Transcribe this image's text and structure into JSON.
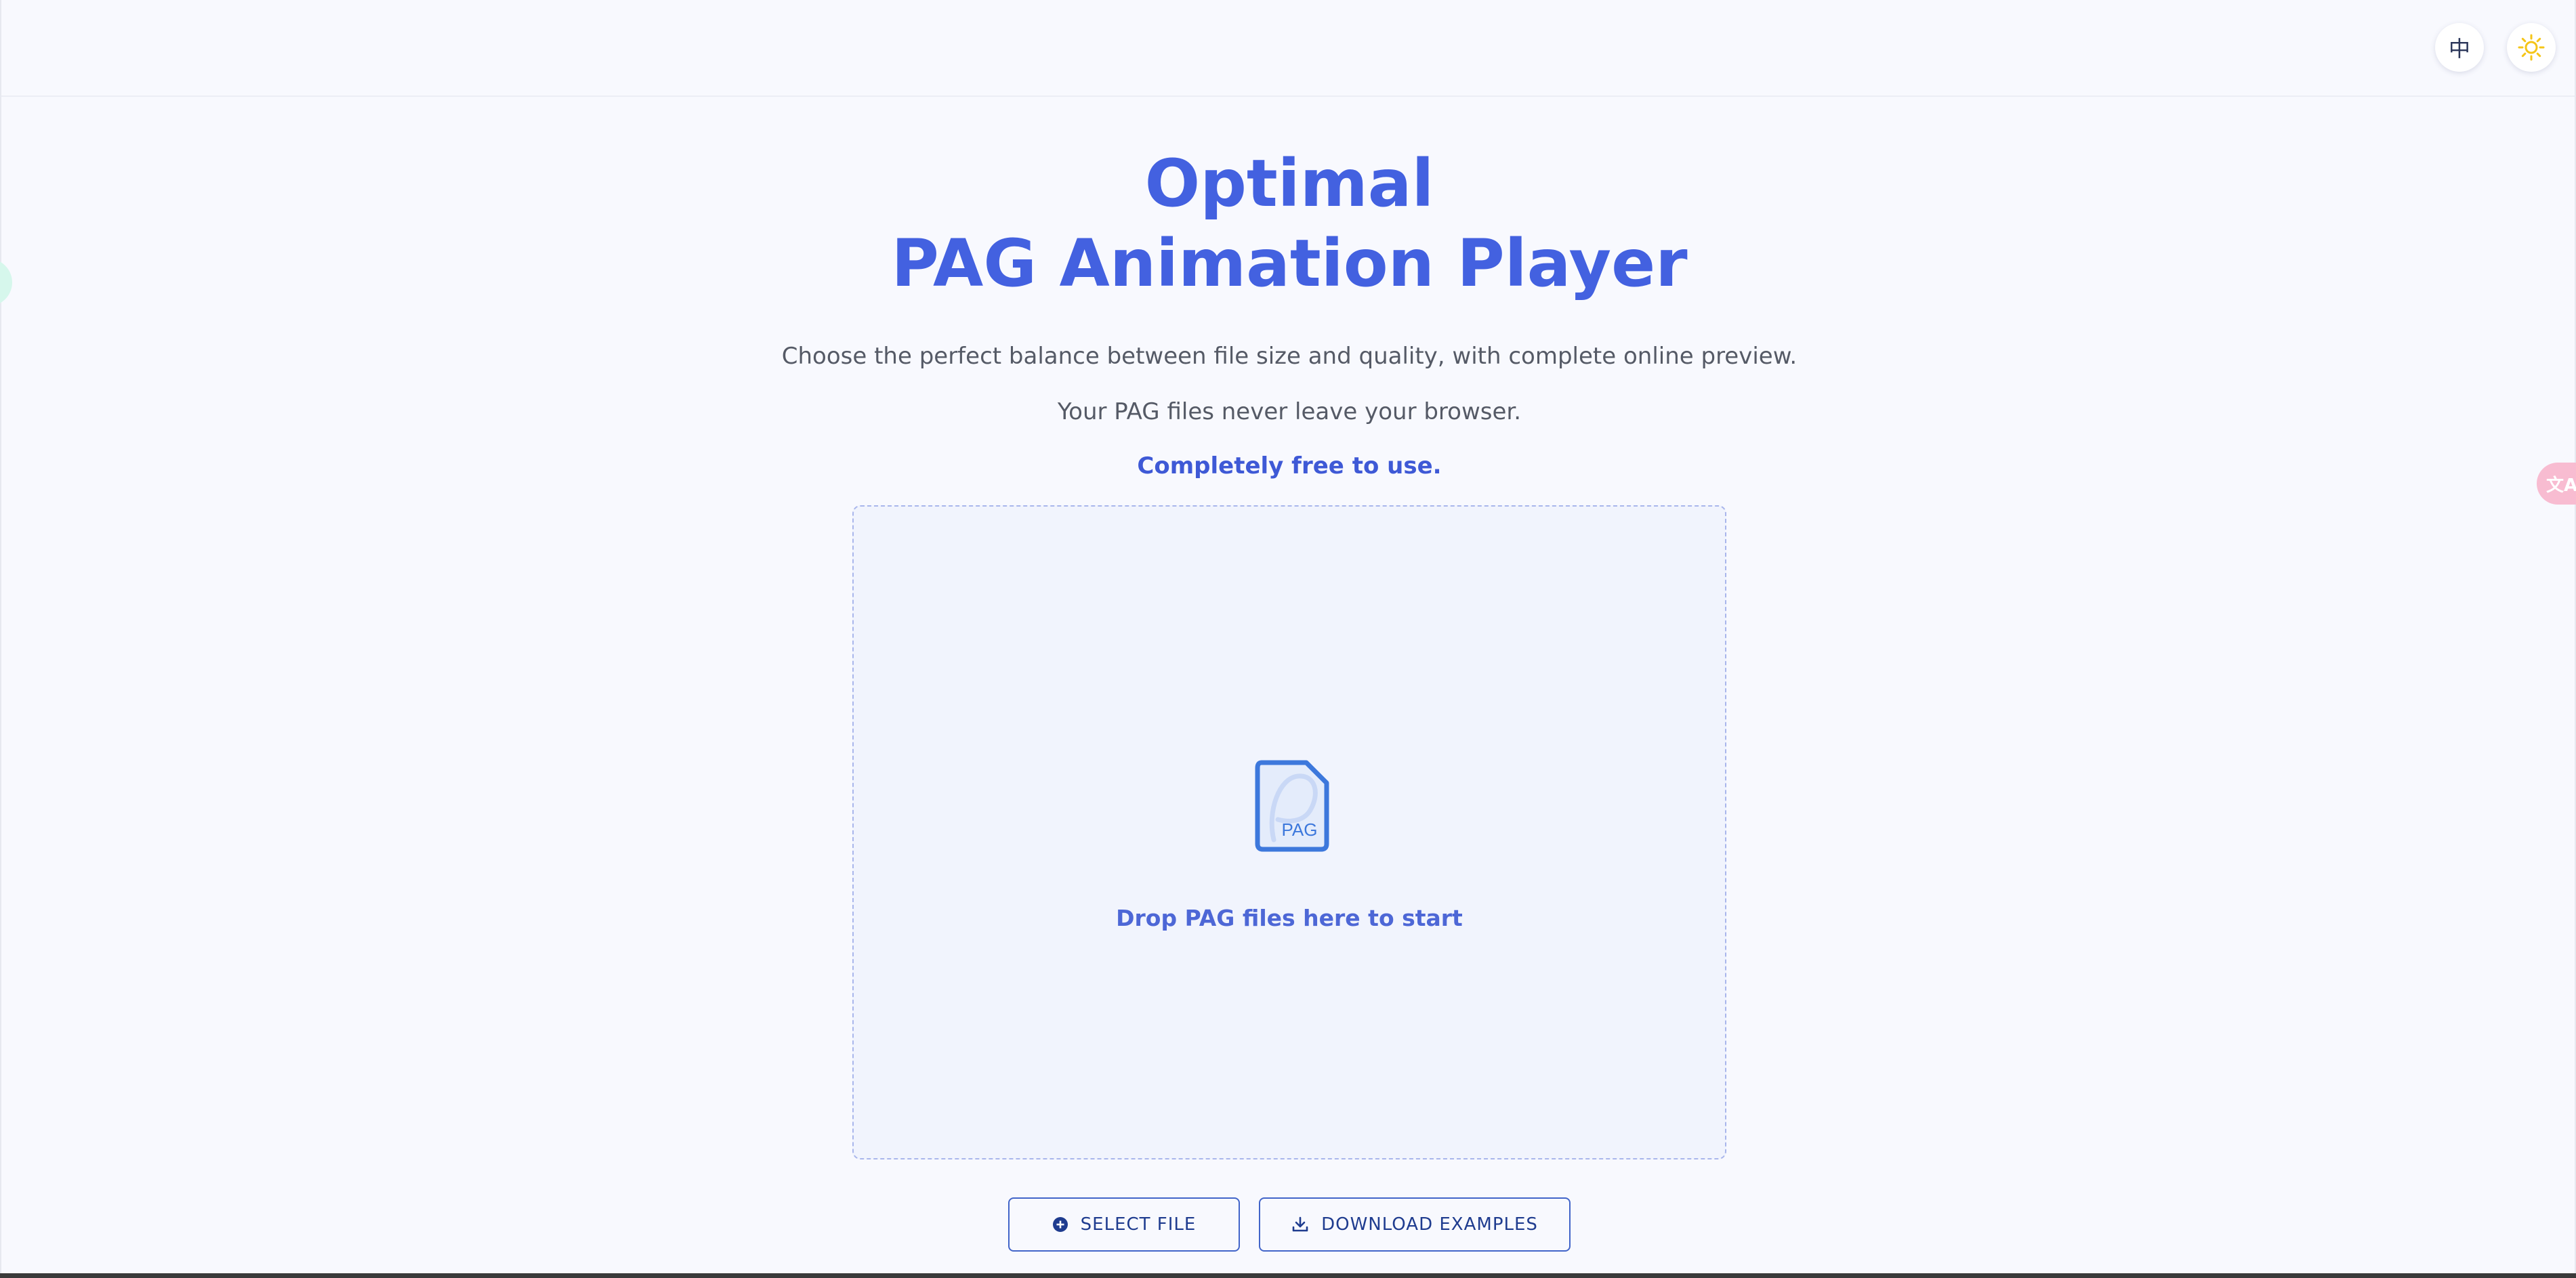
{
  "header": {
    "language_button_label": "中",
    "theme_icon": "sun-icon"
  },
  "hero": {
    "title_line1": "Optimal",
    "title_line2": "PAG Animation Player",
    "description": "Choose the perfect balance between file size and quality, with complete online preview.",
    "privacy_note": "Your PAG files never leave your browser.",
    "free_note": "Completely free to use."
  },
  "dropzone": {
    "icon_label": "PAG",
    "prompt": "Drop PAG files here to start"
  },
  "actions": {
    "select_file_label": "SELECT FILE",
    "download_examples_label": "DOWNLOAD EXAMPLES"
  },
  "floating": {
    "translate_icon": "translate-icon"
  },
  "colors": {
    "accent": "#4361e0",
    "background": "#f8f9fe",
    "dropzone_bg": "#f1f4fd",
    "button_border": "#4265c9",
    "theme_sun": "#f5c518",
    "translate_tab": "#f8bcd1",
    "left_tab": "#d6f7ec"
  }
}
